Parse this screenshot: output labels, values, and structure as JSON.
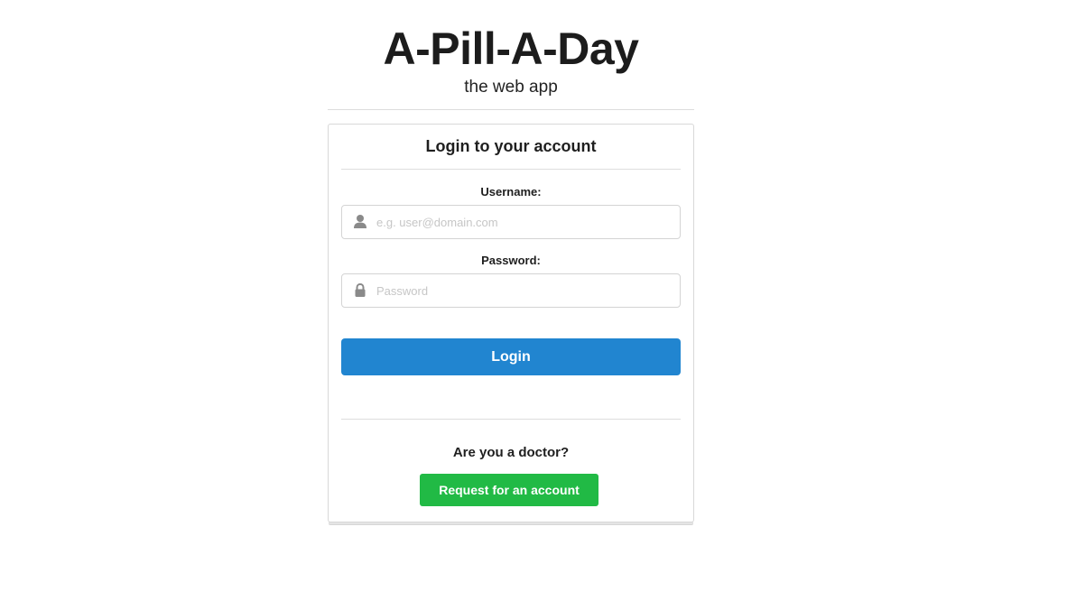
{
  "header": {
    "title": "A-Pill-A-Day",
    "subtitle": "the web app"
  },
  "login_card": {
    "title": "Login to your account",
    "username": {
      "label": "Username:",
      "placeholder": "e.g. user@domain.com",
      "value": "",
      "icon": "user-icon"
    },
    "password": {
      "label": "Password:",
      "placeholder": "Password",
      "value": "",
      "icon": "lock-icon"
    },
    "login_button": "Login",
    "doctor_prompt": "Are you a doctor?",
    "request_button": "Request for an account"
  },
  "colors": {
    "login_button": "#2185d0",
    "request_button": "#21ba45",
    "icon": "#8a8a8a"
  }
}
